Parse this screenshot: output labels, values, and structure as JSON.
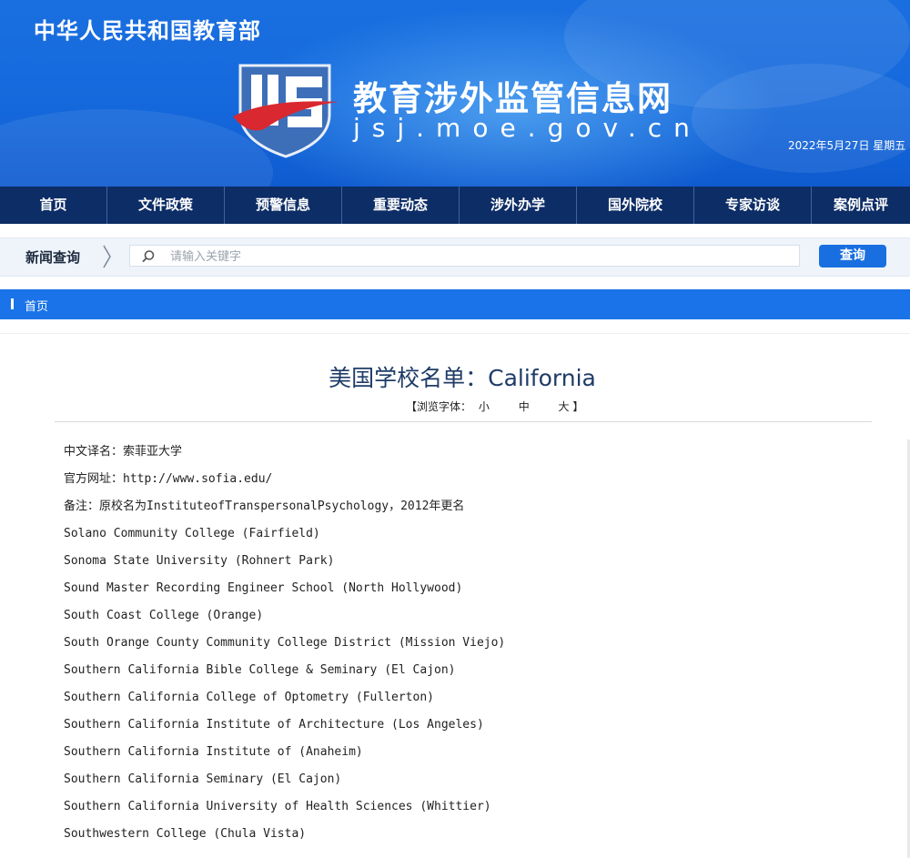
{
  "header": {
    "ministry": "中华人民共和国教育部",
    "site_title": "教育涉外监管信息网",
    "site_domain": "jsj.moe.gov.cn",
    "date": "2022年5月27日 星期五",
    "colors": {
      "banner": "#1569dc",
      "nav": "#0d2d66",
      "accent": "#1a73e8"
    }
  },
  "nav": {
    "items": [
      "首页",
      "文件政策",
      "预警信息",
      "重要动态",
      "涉外办学",
      "国外院校",
      "专家访谈",
      "案例点评"
    ]
  },
  "search": {
    "label": "新闻查询",
    "placeholder": "请输入关键字",
    "value": "",
    "button": "查询",
    "icon": "search-icon"
  },
  "breadcrumb": {
    "home": "首页"
  },
  "article": {
    "title": "美国学校名单：California",
    "font_size": {
      "prefix": "【浏览字体：",
      "small": "小",
      "medium": "中",
      "large": "大",
      "suffix": "】"
    },
    "lines": [
      "中文译名：索菲亚大学",
      "官方网址：http://www.sofia.edu/",
      "备注：原校名为InstituteofTranspersonalPsychology，2012年更名",
      "Solano Community College (Fairfield)",
      "Sonoma State University (Rohnert Park)",
      "Sound Master Recording Engineer School (North Hollywood)",
      "South Coast College (Orange)",
      "South Orange County Community College District (Mission Viejo)",
      "Southern California Bible College & Seminary (El Cajon)",
      "Southern California College of Optometry (Fullerton)",
      "Southern California Institute of Architecture (Los Angeles)",
      "Southern California Institute of (Anaheim)",
      "Southern California Seminary (El Cajon)",
      "Southern California University of Health Sciences (Whittier)",
      "Southwestern College (Chula Vista)"
    ]
  }
}
